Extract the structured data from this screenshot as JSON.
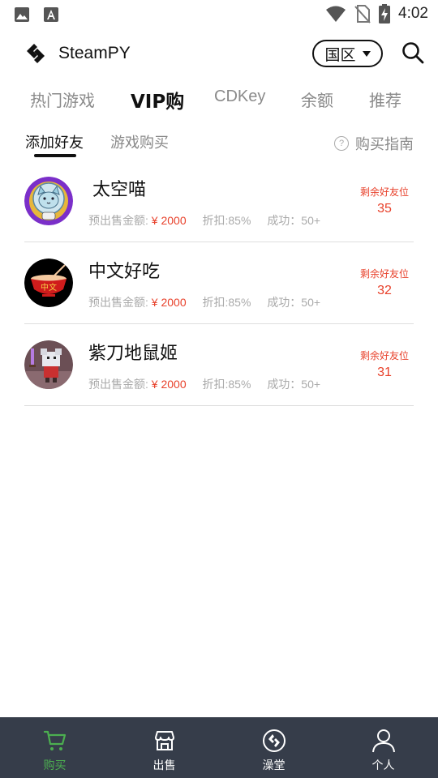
{
  "status_bar": {
    "time": "4:02",
    "left_icons": [
      "image-icon",
      "font-download-icon"
    ],
    "right_icons": [
      "wifi-icon",
      "no-sim-icon",
      "battery-charging-icon"
    ]
  },
  "header": {
    "title": "SteamPY",
    "logo_icon": "steampy-logo-icon",
    "region": "国区",
    "search_icon": "search-icon"
  },
  "main_tabs": [
    {
      "label": "热门游戏",
      "active": false
    },
    {
      "label": "VIP购",
      "active": true
    },
    {
      "label": "CDKey",
      "active": false
    },
    {
      "label": "余额",
      "active": false
    },
    {
      "label": "推荐",
      "active": false
    }
  ],
  "sub_tabs": [
    {
      "label": "添加好友",
      "active": true
    },
    {
      "label": "游戏购买",
      "active": false
    }
  ],
  "guide": {
    "icon": "help-circle-icon",
    "label": "购买指南"
  },
  "colors": {
    "accent_red": "#e8412b",
    "nav_bg": "#363d4a",
    "nav_active": "#4caf50"
  },
  "friends": [
    {
      "name": "太空喵",
      "avatar": "space-cat-avatar",
      "presale_label": "预出售金额:",
      "price": "¥ 2000",
      "discount": "折扣:85%",
      "success": "成功：50+",
      "slots_label": "剩余好友位",
      "slots": "35"
    },
    {
      "name": "中文好吃",
      "avatar": "red-bowl-avatar",
      "presale_label": "预出售金额:",
      "price": "¥ 2000",
      "discount": "折扣:85%",
      "success": "成功：50+",
      "slots_label": "剩余好友位",
      "slots": "32"
    },
    {
      "name": "紫刀地鼠姬",
      "avatar": "pixel-mouse-avatar",
      "presale_label": "预出售金额:",
      "price": "¥ 2000",
      "discount": "折扣:85%",
      "success": "成功：50+",
      "slots_label": "剩余好友位",
      "slots": "31"
    }
  ],
  "bottom_nav": [
    {
      "label": "购买",
      "icon": "cart-icon",
      "active": true
    },
    {
      "label": "出售",
      "icon": "store-icon",
      "active": false
    },
    {
      "label": "澡堂",
      "icon": "steam-circle-icon",
      "active": false
    },
    {
      "label": "个人",
      "icon": "person-icon",
      "active": false
    }
  ]
}
